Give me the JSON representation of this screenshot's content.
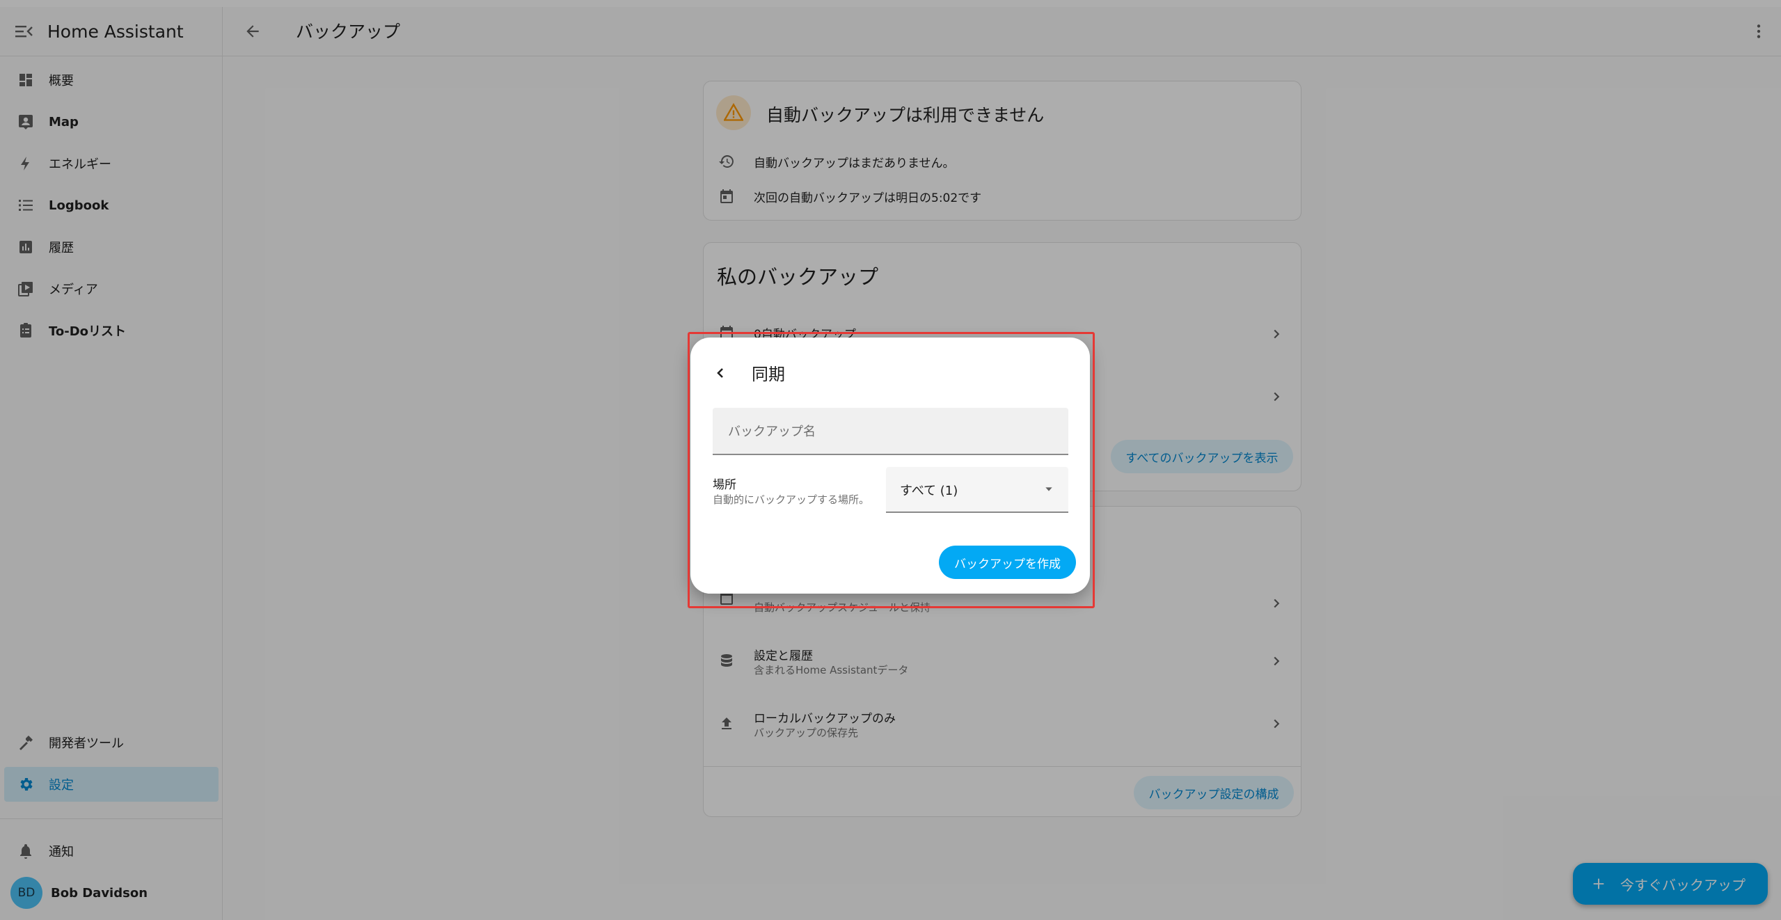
{
  "app": {
    "title": "Home Assistant"
  },
  "sidebar": {
    "items": [
      {
        "label": "概要",
        "icon": "dashboard-icon"
      },
      {
        "label": "Map",
        "icon": "map-icon"
      },
      {
        "label": "エネルギー",
        "icon": "lightning-icon"
      },
      {
        "label": "Logbook",
        "icon": "list-icon"
      },
      {
        "label": "履歴",
        "icon": "chart-icon"
      },
      {
        "label": "メディア",
        "icon": "media-icon"
      },
      {
        "label": "To-Doリスト",
        "icon": "clipboard-list-icon"
      }
    ],
    "bottom": [
      {
        "label": "開発者ツール",
        "icon": "hammer-icon"
      },
      {
        "label": "設定",
        "icon": "gear-icon",
        "active": true
      }
    ],
    "notifications": {
      "label": "通知"
    },
    "user": {
      "initials": "BD",
      "name": "Bob Davidson"
    }
  },
  "header": {
    "title": "バックアップ"
  },
  "status_card": {
    "title": "自動バックアップは利用できません",
    "rows": [
      "自動バックアップはまだありません。",
      "次回の自動バックアップは明日の5:02です"
    ]
  },
  "my_backups": {
    "title": "私のバックアップ",
    "rows": [
      {
        "title": "0自動バックアップ"
      }
    ],
    "show_all_button": "すべてのバックアップを表示"
  },
  "settings_card": {
    "rows": [
      {
        "subtitle": "自動バックアップスケジュールと保持"
      },
      {
        "title": "設定と履歴",
        "subtitle": "含まれるHome Assistantデータ"
      },
      {
        "title": "ローカルバックアップのみ",
        "subtitle": "バックアップの保存先"
      }
    ],
    "configure_button": "バックアップ設定の構成"
  },
  "fab": {
    "label": "今すぐバックアップ"
  },
  "dialog": {
    "title": "同期",
    "name_field": {
      "placeholder": "バックアップ名",
      "value": ""
    },
    "location": {
      "label": "場所",
      "description": "自動的にバックアップする場所。",
      "selected": "すべて (1)"
    },
    "create_button": "バックアップを作成"
  },
  "colors": {
    "accent": "#03a9f4",
    "warning": "#ff9800",
    "highlight": "#e53935"
  }
}
